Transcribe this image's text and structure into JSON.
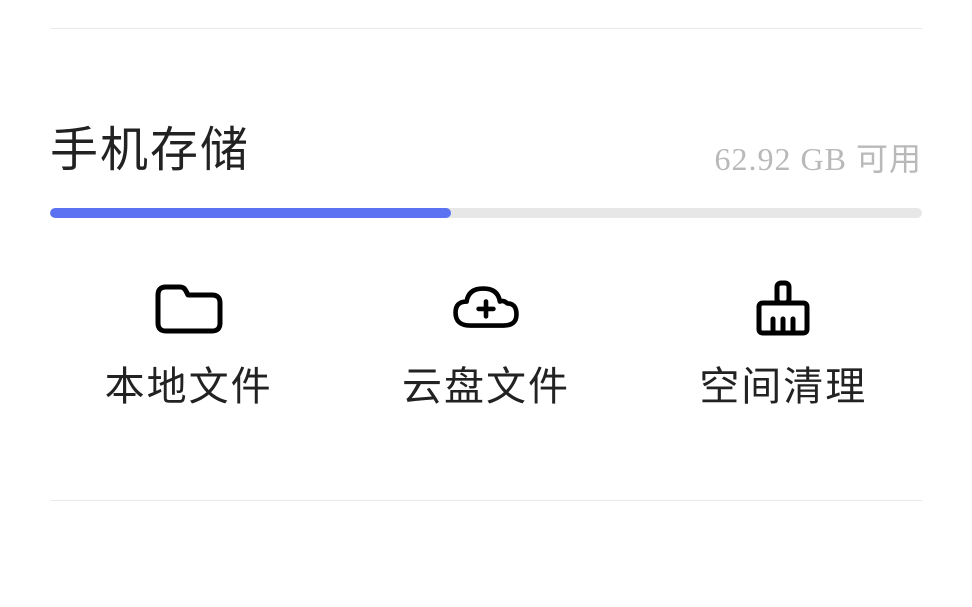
{
  "storage": {
    "title": "手机存储",
    "available_text": "62.92 GB 可用",
    "available_gb": 62.92,
    "used_percent": 46,
    "track_color": "#e7e7e7",
    "fill_color": "#5b72f2"
  },
  "actions": {
    "local": {
      "label": "本地文件",
      "icon": "folder-icon"
    },
    "cloud": {
      "label": "云盘文件",
      "icon": "cloud-plus-icon"
    },
    "clean": {
      "label": "空间清理",
      "icon": "broom-icon"
    }
  }
}
